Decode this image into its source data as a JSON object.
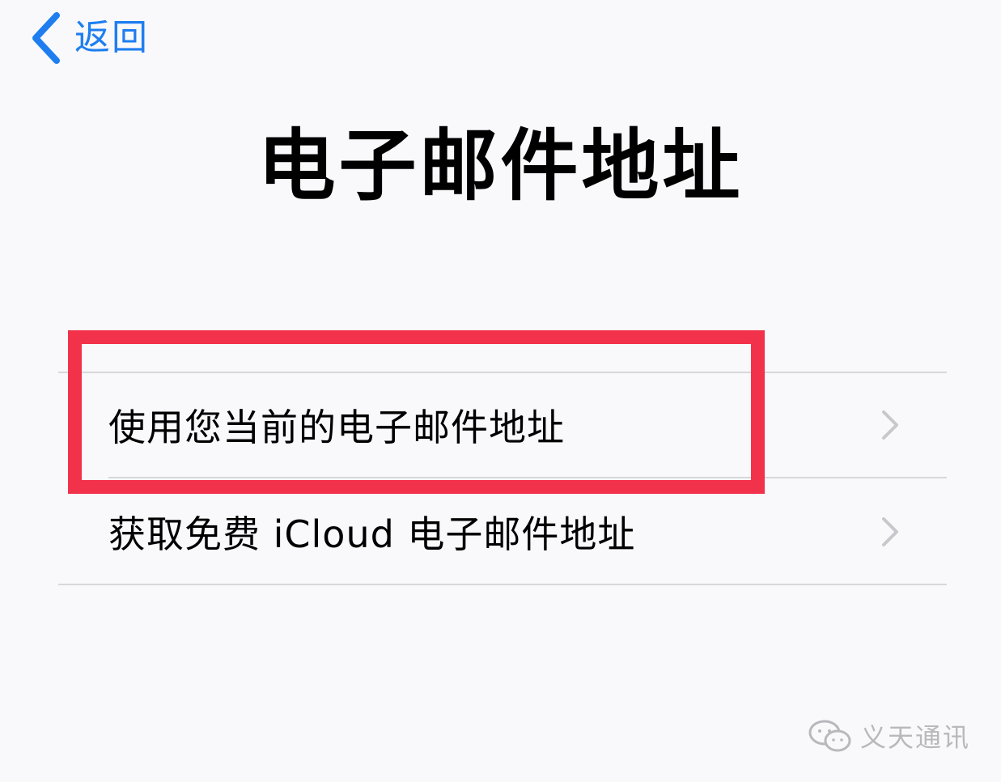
{
  "nav": {
    "back_label": "返回",
    "back_icon": "chevron-left-icon"
  },
  "page": {
    "title": "电子邮件地址"
  },
  "options": [
    {
      "label": "使用您当前的电子邮件地址",
      "icon": "chevron-right-icon",
      "highlighted": true
    },
    {
      "label": "获取免费 iCloud 电子邮件地址",
      "icon": "chevron-right-icon",
      "highlighted": false
    }
  ],
  "watermark": {
    "text": "义天通讯",
    "icon": "wechat-icon"
  },
  "colors": {
    "accent": "#1e7ef0",
    "highlight": "#f2324a",
    "background": "#f9f9fb",
    "separator": "#d7d7dc",
    "chevron": "#c7c7cc"
  }
}
